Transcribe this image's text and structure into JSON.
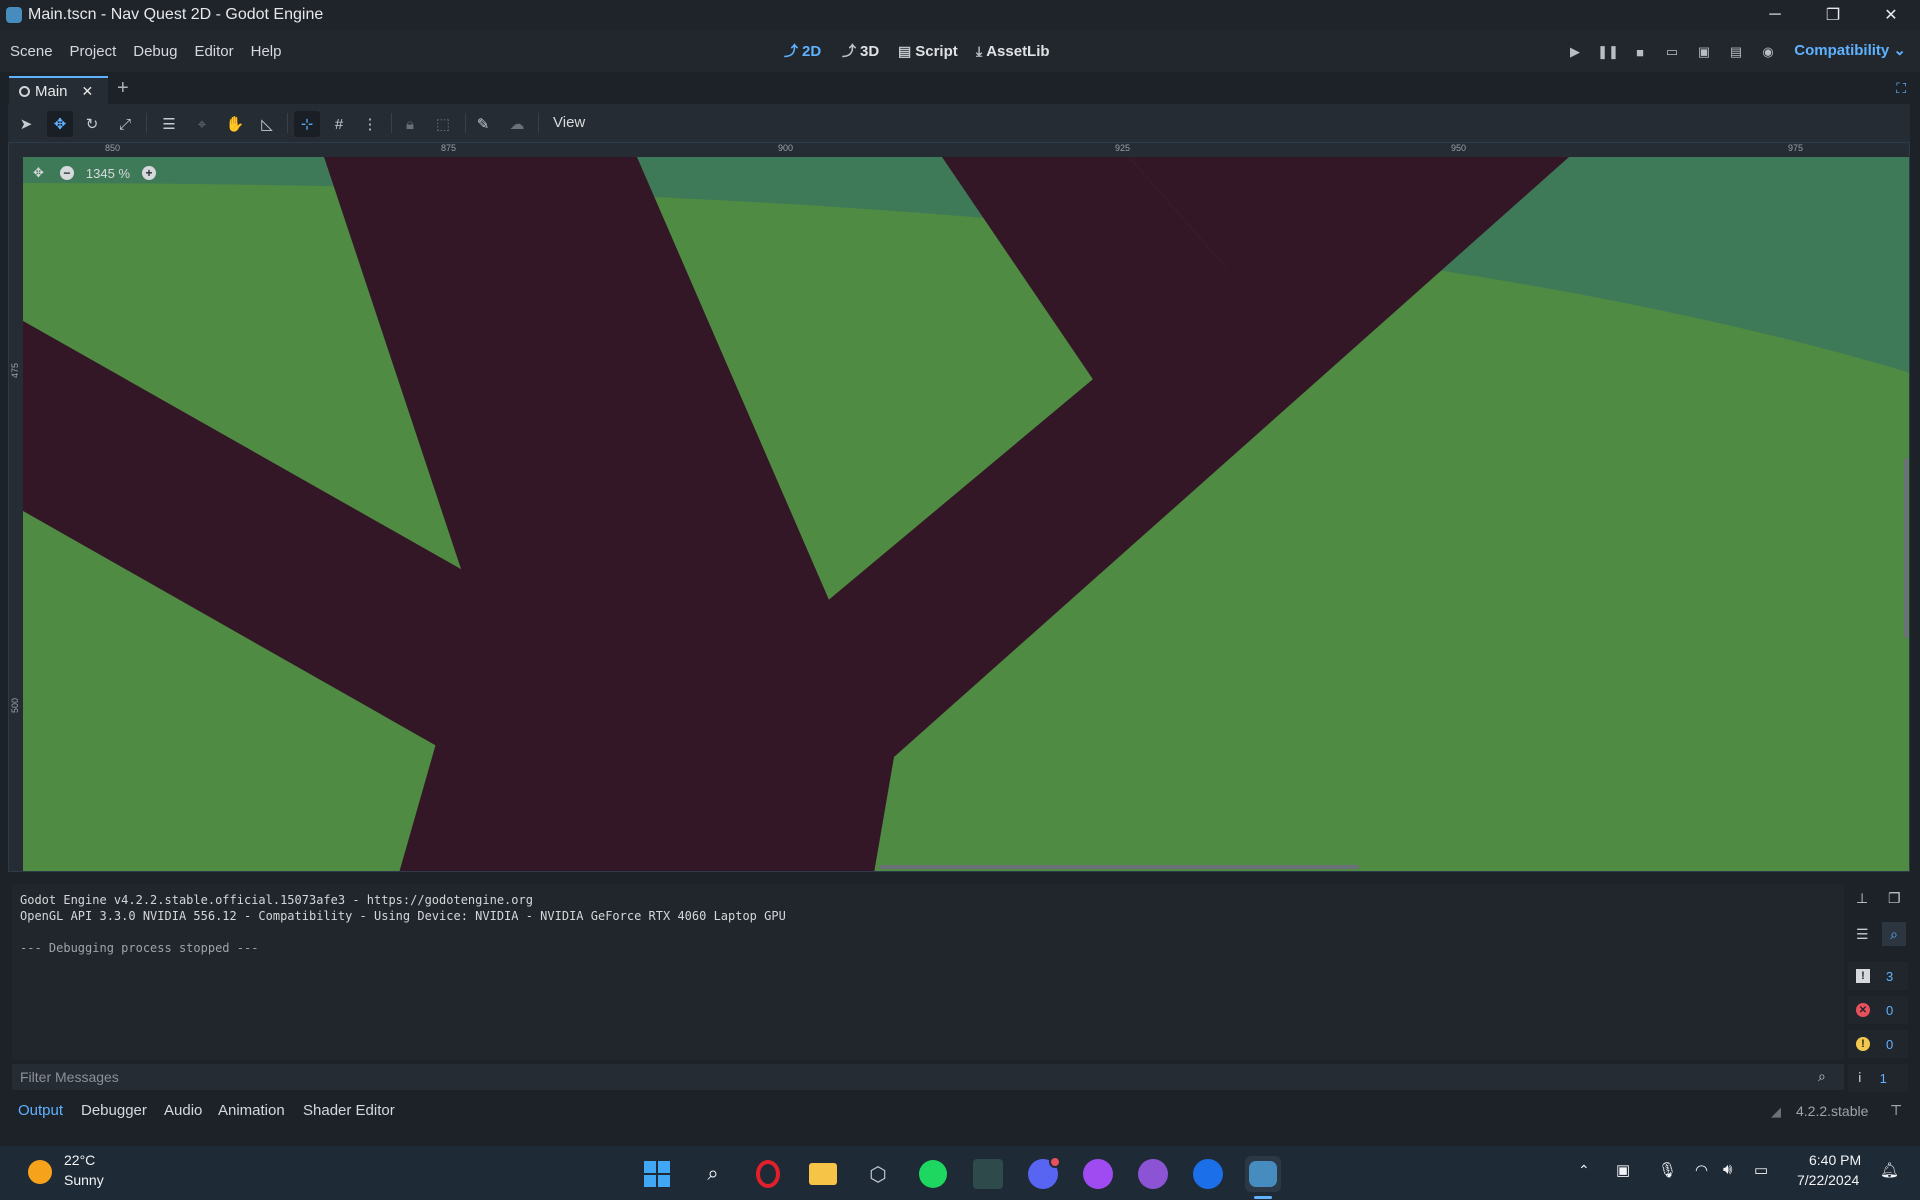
{
  "window": {
    "title": "Main.tscn - Nav Quest 2D - Godot Engine",
    "min": "─",
    "restore": "❐",
    "close": "✕"
  },
  "menu": [
    "Scene",
    "Project",
    "Debug",
    "Editor",
    "Help"
  ],
  "workspaces": [
    {
      "label": "2D",
      "icon": "⤴"
    },
    {
      "label": "3D",
      "icon": "⤴"
    },
    {
      "label": "Script",
      "icon": "▤"
    },
    {
      "label": "AssetLib",
      "icon": "⤓"
    }
  ],
  "renderer": "Compatibility ⌄",
  "scene_tab": {
    "label": "Main",
    "close": "✕",
    "add": "+"
  },
  "toolbar": {
    "view_label": "View"
  },
  "rulers": {
    "h": [
      "850",
      "875",
      "900",
      "925",
      "950",
      "975"
    ],
    "v": [
      "475",
      "500"
    ]
  },
  "zoom": {
    "label": "1345 %"
  },
  "output": {
    "lines": [
      "Godot Engine v4.2.2.stable.official.15073afe3 - https://godotengine.org",
      "OpenGL API 3.3.0 NVIDIA 556.12 - Compatibility - Using Device: NVIDIA - NVIDIA GeForce RTX 4060 Laptop GPU",
      "",
      "--- Debugging process stopped ---"
    ],
    "filter_placeholder": "Filter Messages",
    "counts": {
      "messages": "3",
      "errors": "0",
      "warnings": "0",
      "editor": "1"
    }
  },
  "bottom_tabs": [
    "Output",
    "Debugger",
    "Audio",
    "Animation",
    "Shader Editor"
  ],
  "version": "4.2.2.stable",
  "weather": {
    "temp": "22°C",
    "desc": "Sunny"
  },
  "clock": {
    "time": "6:40 PM",
    "date": "7/22/2024"
  },
  "colors": {
    "accent": "#5fb2ff",
    "grass": "#4e8a41",
    "road": "#341726",
    "water": "#3f7a55"
  }
}
